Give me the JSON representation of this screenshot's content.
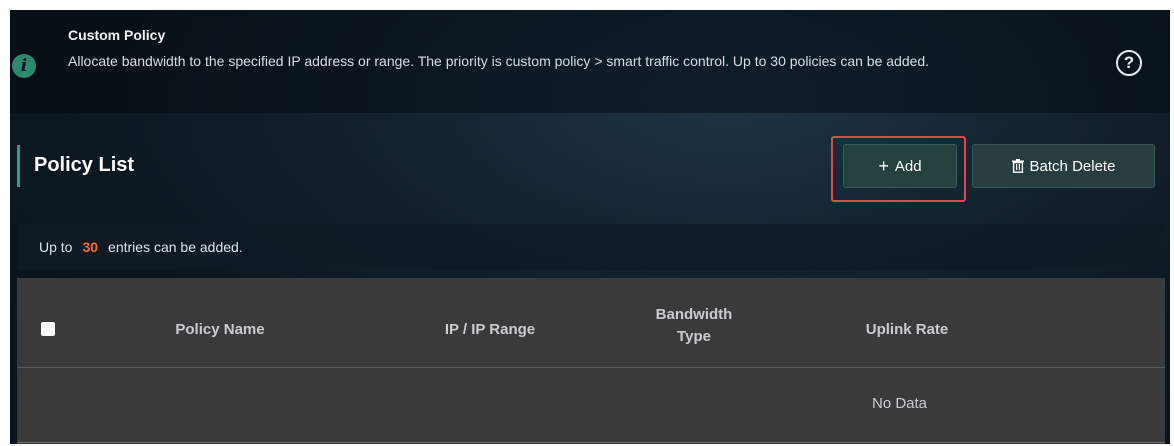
{
  "info": {
    "title": "Custom Policy",
    "description": "Allocate bandwidth to the specified IP address or range. The priority is custom policy > smart traffic control. Up to 30 policies can be added.",
    "info_icon": "i",
    "help_icon": "?"
  },
  "section": {
    "title": "Policy List",
    "add_button": {
      "icon": "+",
      "label": "Add"
    },
    "batch_delete_button": {
      "icon": "trash-icon",
      "label": "Batch Delete"
    }
  },
  "notice": {
    "prefix": "Up to",
    "count": "30",
    "suffix": "entries can be added."
  },
  "table": {
    "columns": [
      "Policy Name",
      "IP / IP Range",
      "Bandwidth Type",
      "Uplink Rate"
    ],
    "empty_text": "No Data"
  },
  "colors": {
    "accent": "#2fa37f",
    "highlight": "#e0484d",
    "count": "#ff6a1a"
  }
}
